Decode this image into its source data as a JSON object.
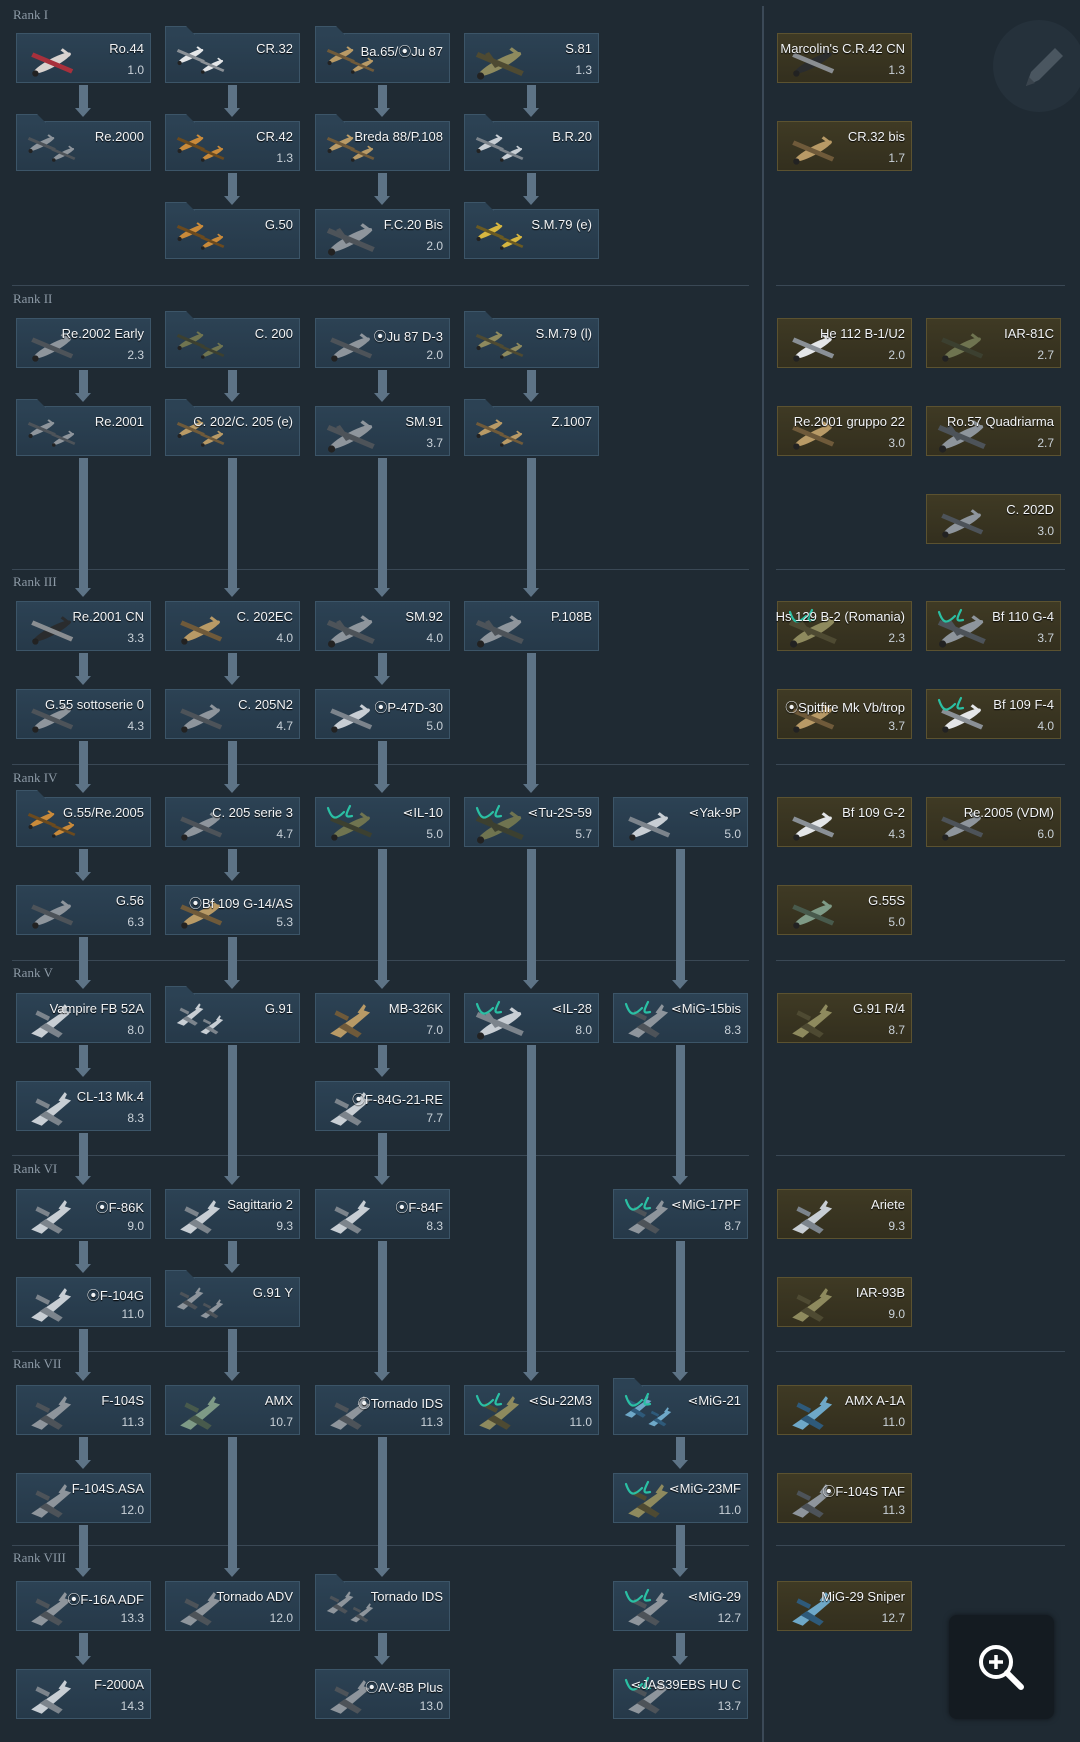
{
  "ranks": [
    {
      "label": "Rank I"
    },
    {
      "label": "Rank II"
    },
    {
      "label": "Rank III"
    },
    {
      "label": "Rank IV"
    },
    {
      "label": "Rank V"
    },
    {
      "label": "Rank VI"
    },
    {
      "label": "Rank VII"
    },
    {
      "label": "Rank VIII"
    }
  ],
  "vehicles": [
    {
      "name": "Ro.44",
      "br": "1.0",
      "type": "biplane",
      "palette": "red-white"
    },
    {
      "name": "CR.32",
      "br": "",
      "type": "biplane-group",
      "palette": "white"
    },
    {
      "name": "Ba.65/⦿Ju 87",
      "br": "",
      "type": "fighter-group",
      "palette": "tan"
    },
    {
      "name": "S.81",
      "br": "1.3",
      "type": "bomber",
      "palette": "camo"
    },
    {
      "name": "Marcolin's C.R.42 CN",
      "br": "1.3",
      "type": "biplane",
      "palette": "black",
      "premium": true
    },
    {
      "name": "Re.2000",
      "br": "",
      "type": "fighter-group",
      "palette": "grey"
    },
    {
      "name": "CR.42",
      "br": "1.3",
      "type": "biplane-group",
      "palette": "orange"
    },
    {
      "name": "Breda 88/P.108",
      "br": "",
      "type": "fighter-group",
      "palette": "tan"
    },
    {
      "name": "B.R.20",
      "br": "",
      "type": "bomber-group",
      "palette": "silver"
    },
    {
      "name": "CR.32 bis",
      "br": "1.7",
      "type": "biplane",
      "palette": "tan",
      "premium": true
    },
    {
      "name": "G.50",
      "br": "",
      "type": "fighter-group",
      "palette": "orange"
    },
    {
      "name": "F.C.20 Bis",
      "br": "2.0",
      "type": "bomber",
      "palette": "grey"
    },
    {
      "name": "S.M.79 (e)",
      "br": "",
      "type": "bomber-group",
      "palette": "yellow"
    },
    {
      "name": "Re.2002 Early",
      "br": "2.3",
      "type": "fighter",
      "palette": "grey"
    },
    {
      "name": "C. 200",
      "br": "",
      "type": "fighter-group",
      "palette": "olive"
    },
    {
      "name": "⦿Ju 87 D-3",
      "br": "2.0",
      "type": "fighter",
      "palette": "grey"
    },
    {
      "name": "S.M.79 (l)",
      "br": "",
      "type": "bomber-group",
      "palette": "camo"
    },
    {
      "name": "He 112 B-1/U2",
      "br": "2.0",
      "type": "fighter",
      "palette": "white",
      "premium": true
    },
    {
      "name": "IAR-81C",
      "br": "2.7",
      "type": "fighter",
      "palette": "olive",
      "premium": true
    },
    {
      "name": "Re.2001",
      "br": "",
      "type": "fighter-group",
      "palette": "grey"
    },
    {
      "name": "C. 202/C. 205 (e)",
      "br": "",
      "type": "fighter-group",
      "palette": "tan"
    },
    {
      "name": "SM.91",
      "br": "3.7",
      "type": "twin",
      "palette": "grey"
    },
    {
      "name": "Z.1007",
      "br": "",
      "type": "bomber-group",
      "palette": "tan"
    },
    {
      "name": "Re.2001 gruppo 22",
      "br": "3.0",
      "type": "fighter",
      "palette": "tan",
      "premium": true
    },
    {
      "name": "Ro.57 Quadriarma",
      "br": "2.7",
      "type": "twin",
      "palette": "grey",
      "premium": true
    },
    {
      "name": "C. 202D",
      "br": "3.0",
      "type": "fighter",
      "palette": "grey",
      "premium": true
    },
    {
      "name": "Re.2001 CN",
      "br": "3.3",
      "type": "fighter",
      "palette": "black"
    },
    {
      "name": "C. 202EC",
      "br": "4.0",
      "type": "fighter",
      "palette": "tan"
    },
    {
      "name": "SM.92",
      "br": "4.0",
      "type": "twin",
      "palette": "grey"
    },
    {
      "name": "P.108B",
      "br": "",
      "type": "bomber",
      "palette": "grey"
    },
    {
      "name": "Hs 129 B-2 (Romania)",
      "br": "2.3",
      "type": "twin",
      "palette": "camo",
      "premium": true
    },
    {
      "name": "Bf 110 G-4",
      "br": "3.7",
      "type": "twin",
      "palette": "grey",
      "premium": true
    },
    {
      "name": "G.55 sottoserie 0",
      "br": "4.3",
      "type": "fighter",
      "palette": "grey"
    },
    {
      "name": "C. 205N2",
      "br": "4.7",
      "type": "fighter",
      "palette": "grey"
    },
    {
      "name": "⦿P-47D-30",
      "br": "5.0",
      "type": "fighter",
      "palette": "silver"
    },
    {
      "name": "⦿Spitfire Mk Vb/trop",
      "br": "3.7",
      "type": "fighter",
      "palette": "tan",
      "premium": true
    },
    {
      "name": "Bf 109 F-4",
      "br": "4.0",
      "type": "fighter",
      "palette": "white",
      "premium": true
    },
    {
      "name": "G.55/Re.2005",
      "br": "",
      "type": "fighter-group",
      "palette": "orange"
    },
    {
      "name": "C. 205 serie 3",
      "br": "4.7",
      "type": "fighter",
      "palette": "grey"
    },
    {
      "name": "IL-10",
      "br": "5.0",
      "type": "fighter",
      "palette": "olive"
    },
    {
      "name": "Tu-2S-59",
      "br": "5.7",
      "type": "twin",
      "palette": "olive"
    },
    {
      "name": "Yak-9P",
      "br": "5.0",
      "type": "fighter",
      "palette": "silver"
    },
    {
      "name": "Bf 109 G-2",
      "br": "4.3",
      "type": "fighter",
      "palette": "white",
      "premium": true
    },
    {
      "name": "Re.2005 (VDM)",
      "br": "6.0",
      "type": "fighter",
      "palette": "grey",
      "premium": true
    },
    {
      "name": "G.56",
      "br": "6.3",
      "type": "fighter",
      "palette": "grey"
    },
    {
      "name": "⦿Bf 109 G-14/AS",
      "br": "5.3",
      "type": "fighter",
      "palette": "tan"
    },
    {
      "name": "G.55S",
      "br": "5.0",
      "type": "fighter",
      "palette": "green",
      "premium": true
    },
    {
      "name": "Vampire FB 52A",
      "br": "8.0",
      "type": "jet",
      "palette": "silver"
    },
    {
      "name": "G.91",
      "br": "",
      "type": "jet-group",
      "palette": "silver"
    },
    {
      "name": "MB-326K",
      "br": "7.0",
      "type": "jet",
      "palette": "tan"
    },
    {
      "name": "IL-28",
      "br": "8.0",
      "type": "bomber",
      "palette": "silver"
    },
    {
      "name": "MiG-15bis",
      "br": "8.3",
      "type": "jet",
      "palette": "grey"
    },
    {
      "name": "G.91 R/4",
      "br": "8.7",
      "type": "jet",
      "palette": "camo",
      "premium": true
    },
    {
      "name": "CL-13 Mk.4",
      "br": "8.3",
      "type": "jet",
      "palette": "silver"
    },
    {
      "name": "⦿F-84G-21-RE",
      "br": "7.7",
      "type": "jet",
      "palette": "silver"
    },
    {
      "name": "⦿F-86K",
      "br": "9.0",
      "type": "jet",
      "palette": "silver"
    },
    {
      "name": "Sagittario 2",
      "br": "9.3",
      "type": "jet",
      "palette": "silver"
    },
    {
      "name": "⦿F-84F",
      "br": "8.3",
      "type": "jet",
      "palette": "silver"
    },
    {
      "name": "MiG-17PF",
      "br": "8.7",
      "type": "jet",
      "palette": "grey"
    },
    {
      "name": "Ariete",
      "br": "9.3",
      "type": "jet",
      "palette": "silver",
      "premium": true
    },
    {
      "name": "⦿F-104G",
      "br": "11.0",
      "type": "jet",
      "palette": "silver"
    },
    {
      "name": "G.91 Y",
      "br": "",
      "type": "jet-group",
      "palette": "grey"
    },
    {
      "name": "IAR-93B",
      "br": "9.0",
      "type": "jet",
      "palette": "camo",
      "premium": true
    },
    {
      "name": "F-104S",
      "br": "11.3",
      "type": "jet",
      "palette": "grey"
    },
    {
      "name": "AMX",
      "br": "10.7",
      "type": "jet",
      "palette": "green"
    },
    {
      "name": "⦿Tornado IDS",
      "br": "11.3",
      "type": "jet",
      "palette": "grey"
    },
    {
      "name": "Su-22M3",
      "br": "11.0",
      "type": "jet",
      "palette": "camo"
    },
    {
      "name": "MiG-21",
      "br": "",
      "type": "jet-group",
      "palette": "blue"
    },
    {
      "name": "AMX A-1A",
      "br": "11.0",
      "type": "jet",
      "palette": "blue",
      "premium": true
    },
    {
      "name": "F-104S.ASA",
      "br": "12.0",
      "type": "jet",
      "palette": "grey"
    },
    {
      "name": "MiG-23MF",
      "br": "11.0",
      "type": "jet",
      "palette": "camo"
    },
    {
      "name": "⦿F-104S TAF",
      "br": "11.3",
      "type": "jet",
      "palette": "grey",
      "premium": true
    },
    {
      "name": "⦿F-16A ADF",
      "br": "13.3",
      "type": "jet",
      "palette": "grey"
    },
    {
      "name": "Tornado ADV",
      "br": "12.0",
      "type": "jet",
      "palette": "grey"
    },
    {
      "name": "Tornado IDS",
      "br": "",
      "type": "jet-group",
      "palette": "grey"
    },
    {
      "name": "MiG-29",
      "br": "12.7",
      "type": "jet",
      "palette": "grey"
    },
    {
      "name": "MiG-29 Sniper",
      "br": "12.7",
      "type": "jet",
      "palette": "blue",
      "premium": true
    },
    {
      "name": "F-2000A",
      "br": "14.3",
      "type": "jet",
      "palette": "silver"
    },
    {
      "name": "⦿AV-8B Plus",
      "br": "13.0",
      "type": "jet",
      "palette": "grey"
    },
    {
      "name": "JAS39EBS HU C",
      "br": "13.7",
      "type": "jet",
      "palette": "grey"
    }
  ],
  "colors": {
    "background": "#1f2a33",
    "card_standard": "#2a3f51",
    "card_premium": "#3b3622",
    "arrow": "#5d7386",
    "text": "#f2f4f6",
    "br_text": "#c9d1d8",
    "rank_label": "#8d9aa6",
    "teal_mark": "#2ac0a4"
  },
  "controls": {
    "edit_icon": "pencil-icon",
    "zoom_icon": "zoom-in-icon"
  }
}
